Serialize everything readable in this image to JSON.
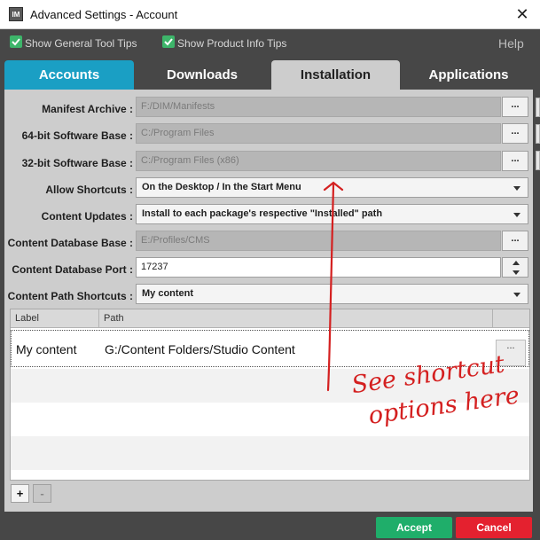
{
  "window": {
    "app_icon_text": "IM",
    "title": "Advanced Settings - Account",
    "close_glyph": "✕"
  },
  "options": {
    "show_general_tool_tips": {
      "label": "Show General Tool Tips",
      "checked": true
    },
    "show_product_info_tips": {
      "label": "Show Product Info Tips",
      "checked": true
    },
    "help_label": "Help"
  },
  "tabs": [
    {
      "label": "Accounts",
      "active": false
    },
    {
      "label": "Downloads",
      "active": false
    },
    {
      "label": "Installation",
      "active": true
    },
    {
      "label": "Applications",
      "active": false
    }
  ],
  "installation": {
    "manifest_archive": {
      "label": "Manifest Archive :",
      "value": "F:/DIM/Manifests",
      "browse": "..."
    },
    "software_base_64": {
      "label": "64-bit Software Base :",
      "value": "C:/Program Files",
      "browse": "..."
    },
    "software_base_32": {
      "label": "32-bit Software Base :",
      "value": "C:/Program Files (x86)",
      "browse": "..."
    },
    "allow_shortcuts": {
      "label": "Allow Shortcuts :",
      "value": "On the Desktop / In the Start Menu"
    },
    "content_updates": {
      "label": "Content Updates :",
      "value": "Install to each package's respective \"Installed\" path"
    },
    "content_database_base": {
      "label": "Content Database Base :",
      "value": "E:/Profiles/CMS",
      "browse": "..."
    },
    "content_database_port": {
      "label": "Content Database Port :",
      "value": "17237"
    },
    "content_path_shortcuts": {
      "label": "Content Path Shortcuts :",
      "value": "My content"
    }
  },
  "table": {
    "columns": [
      "Label",
      "Path"
    ],
    "rows": [
      {
        "label": "My content",
        "path": "G:/Content Folders/Studio Content",
        "browse": "..."
      }
    ]
  },
  "list_buttons": {
    "add": "+",
    "remove": "-"
  },
  "footer": {
    "accept": "Accept",
    "cancel": "Cancel"
  },
  "annotation": {
    "text": "See shortcut options here",
    "color": "#d42020"
  },
  "colors": {
    "accent": "#1a9fc4",
    "accept": "#1fae6a",
    "cancel": "#e4212f",
    "check": "#3db56a"
  }
}
